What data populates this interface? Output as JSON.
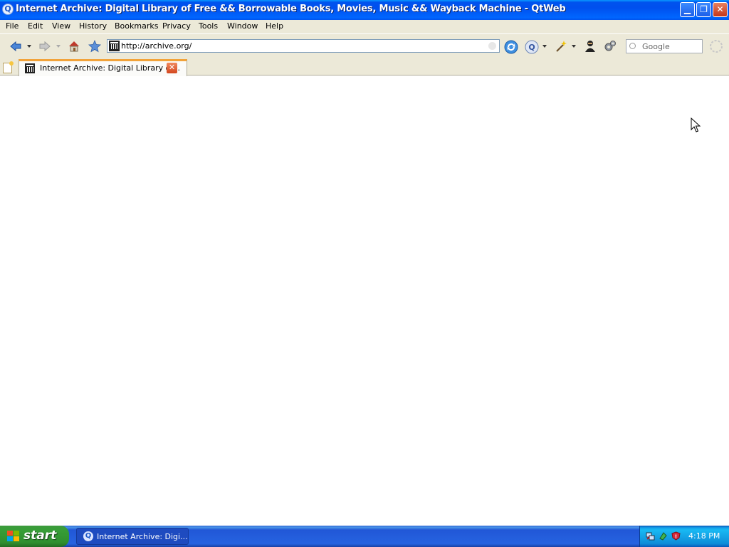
{
  "window": {
    "title": "Internet Archive: Digital Library of Free && Borrowable Books, Movies, Music && Wayback Machine - QtWeb",
    "app_icon_glyph": "Q",
    "minimize_glyph": "▁",
    "maximize_glyph": "❐",
    "close_glyph": "✕"
  },
  "menu": {
    "items": [
      "File",
      "Edit",
      "View",
      "History",
      "Bookmarks",
      "Privacy",
      "Tools",
      "Window",
      "Help"
    ]
  },
  "toolbar": {
    "url": "http://archive.org/",
    "search_placeholder": "Google",
    "icons": [
      "back-icon",
      "forward-icon",
      "home-icon",
      "bookmark-star-icon",
      "reload-icon",
      "qtweb-icon",
      "magic-wand-icon",
      "privacy-person-icon",
      "settings-gears-icon",
      "loading-spinner-icon"
    ]
  },
  "tabs": [
    {
      "title": "Internet Archive: Digital Library of...",
      "close_glyph": "✕",
      "active": true
    }
  ],
  "taskbar": {
    "start_label": "start",
    "item_label": "Internet Archive: Digi...",
    "item_icon_glyph": "Q",
    "clock": "4:18 PM"
  },
  "colors": {
    "titlebar": "#0050ee",
    "menubar": "#ece9d8",
    "tab_accent": "#f2a33a",
    "taskbar": "#2663e0",
    "start_button": "#379e37"
  }
}
